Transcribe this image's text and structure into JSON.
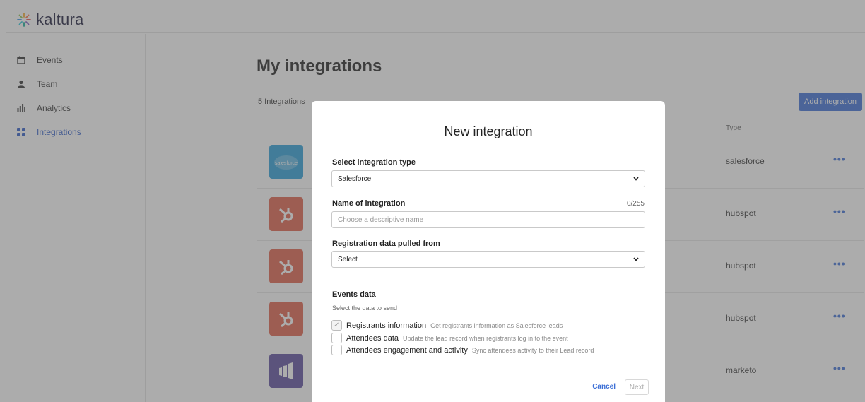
{
  "brand": {
    "name": "kaltura"
  },
  "sidebar": {
    "items": [
      {
        "label": "Events",
        "icon": "calendar-icon",
        "active": false
      },
      {
        "label": "Team",
        "icon": "user-icon",
        "active": false
      },
      {
        "label": "Analytics",
        "icon": "bar-chart-icon",
        "active": false
      },
      {
        "label": "Integrations",
        "icon": "integrations-icon",
        "active": true
      }
    ]
  },
  "main": {
    "title": "My integrations",
    "count_label": "5 Integrations",
    "add_button": "Add integration",
    "type_header": "Type",
    "rows": [
      {
        "type": "salesforce",
        "logo": "salesforce-logo",
        "more": "•••"
      },
      {
        "type": "hubspot",
        "logo": "hubspot-logo",
        "more": "•••"
      },
      {
        "type": "hubspot",
        "logo": "hubspot-logo",
        "more": "•••"
      },
      {
        "type": "hubspot",
        "logo": "hubspot-logo",
        "more": "•••"
      },
      {
        "type": "marketo",
        "logo": "marketo-logo",
        "more": "•••"
      }
    ]
  },
  "modal": {
    "title": "New integration",
    "type_label": "Select integration type",
    "type_value": "Salesforce",
    "name_label": "Name of integration",
    "name_counter": "0/255",
    "name_value": "",
    "name_placeholder": "Choose a descriptive name",
    "source_label": "Registration data pulled from",
    "source_value": "Select",
    "events_title": "Events data",
    "events_sub": "Select the data to send",
    "checkboxes": [
      {
        "label": "Registrants information",
        "desc": "Get registrants information as Salesforce leads",
        "checked": true
      },
      {
        "label": "Attendees data",
        "desc": "Update the lead record when registrants log in to the event",
        "checked": false
      },
      {
        "label": "Attendees engagement and activity",
        "desc": "Sync attendees activity to their Lead record",
        "checked": false
      }
    ],
    "cancel_label": "Cancel",
    "next_label": "Next"
  },
  "colors": {
    "accent": "#3c6fd6",
    "salesforce": "#2a9fd8",
    "hubspot": "#e0604a",
    "marketo": "#5c4c9f"
  }
}
